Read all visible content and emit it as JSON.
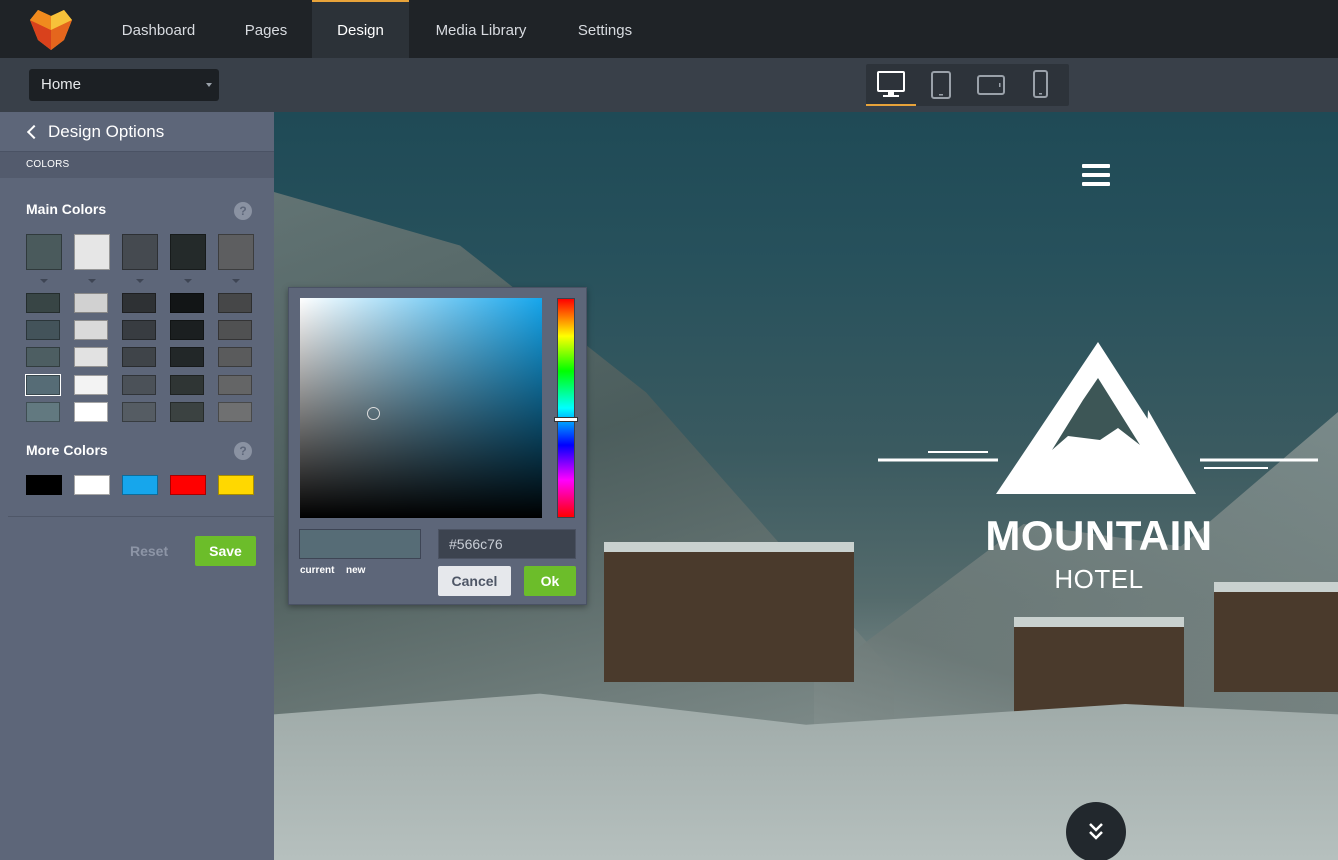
{
  "nav": {
    "items": [
      {
        "label": "Dashboard",
        "active": false
      },
      {
        "label": "Pages",
        "active": false
      },
      {
        "label": "Design",
        "active": true
      },
      {
        "label": "Media Library",
        "active": false
      },
      {
        "label": "Settings",
        "active": false
      }
    ],
    "accent": "#e8a33a"
  },
  "subbar": {
    "page_select": "Home",
    "devices": [
      "desktop-icon",
      "tablet-portrait-icon",
      "tablet-landscape-icon",
      "phone-icon"
    ],
    "active_device": "desktop"
  },
  "sidebar": {
    "header": "Design Options",
    "section": "COLORS",
    "main_colors_title": "Main Colors",
    "more_colors_title": "More Colors",
    "help_glyph": "?",
    "main_colors": [
      "#4a5a5c",
      "#e6e6e6",
      "#454a50",
      "#242a2a",
      "#5d5e60"
    ],
    "shades": [
      [
        "#384545",
        "#d1d1d1",
        "#2e3134",
        "#121516",
        "#464748"
      ],
      [
        "#43535a",
        "#dadada",
        "#383c41",
        "#1b1f20",
        "#505152"
      ],
      [
        "#4d5e62",
        "#e2e2e2",
        "#3f4449",
        "#222728",
        "#5a5b5c"
      ],
      [
        "#566c76",
        "#f3f3f3",
        "#4b5158",
        "#2f3534",
        "#646566"
      ],
      [
        "#627980",
        "#ffffff",
        "#555c63",
        "#3b4241",
        "#6f7071"
      ]
    ],
    "selected_shade": {
      "row": 3,
      "col": 0
    },
    "more_colors": [
      "#000000",
      "#ffffff",
      "#16a6ec",
      "#ff0000",
      "#ffd800"
    ],
    "reset_label": "Reset",
    "save_label": "Save"
  },
  "preview": {
    "brand_title": "MOUNTAIN",
    "brand_subtitle": "HOTEL"
  },
  "color_picker": {
    "current_color": "#566c76",
    "hex_value": "#566c76",
    "current_label": "current",
    "new_label": "new",
    "cancel_label": "Cancel",
    "ok_label": "Ok"
  }
}
